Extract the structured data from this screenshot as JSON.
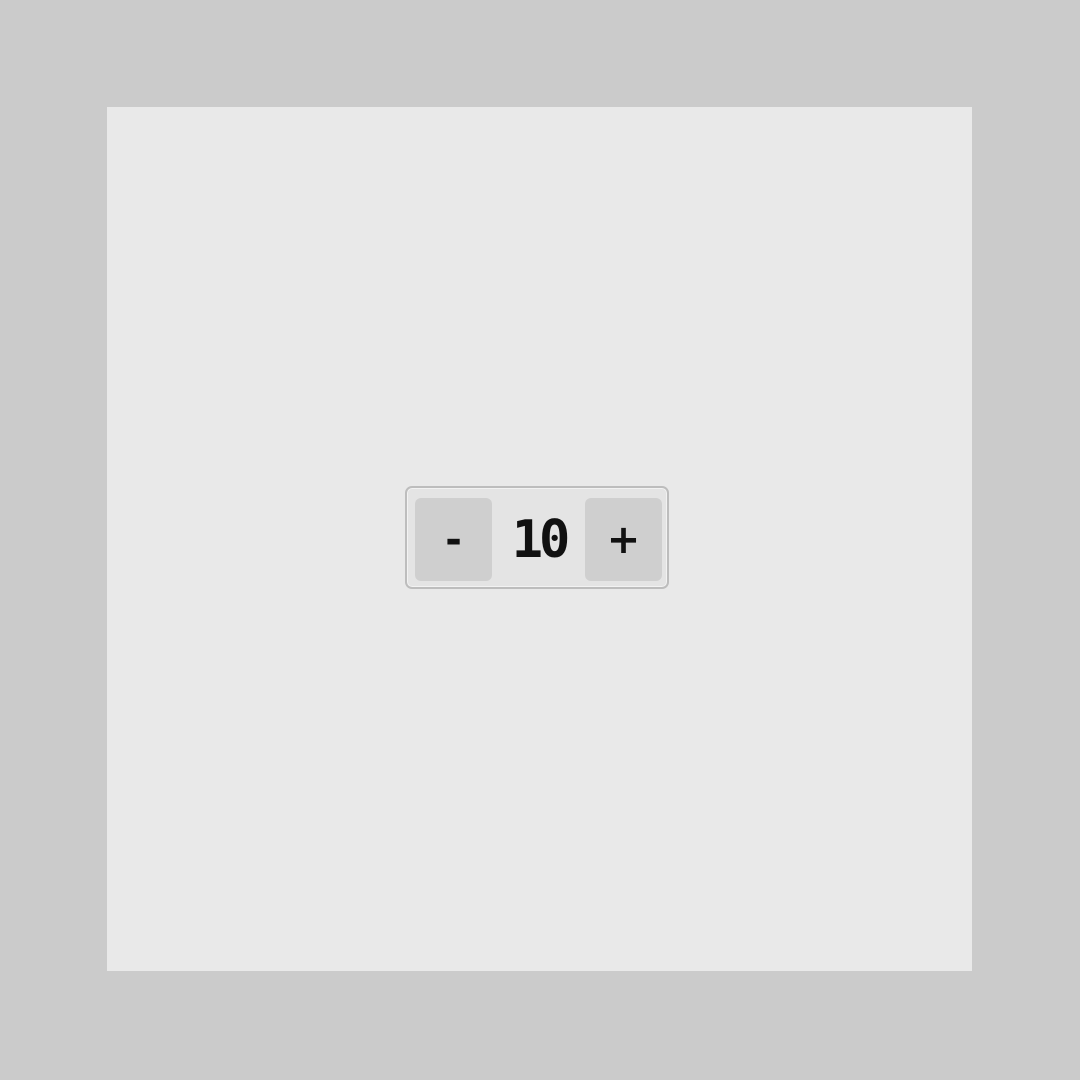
{
  "stepper": {
    "decrement_label": "-",
    "value": "10",
    "increment_label": "+"
  },
  "colors": {
    "outer_background": "#cbcbcb",
    "canvas_background": "#e9e9e9",
    "stepper_background": "#e4e4e4",
    "stepper_border": "#bdbdbd",
    "button_background": "#cfcfcf",
    "text": "#111111"
  }
}
